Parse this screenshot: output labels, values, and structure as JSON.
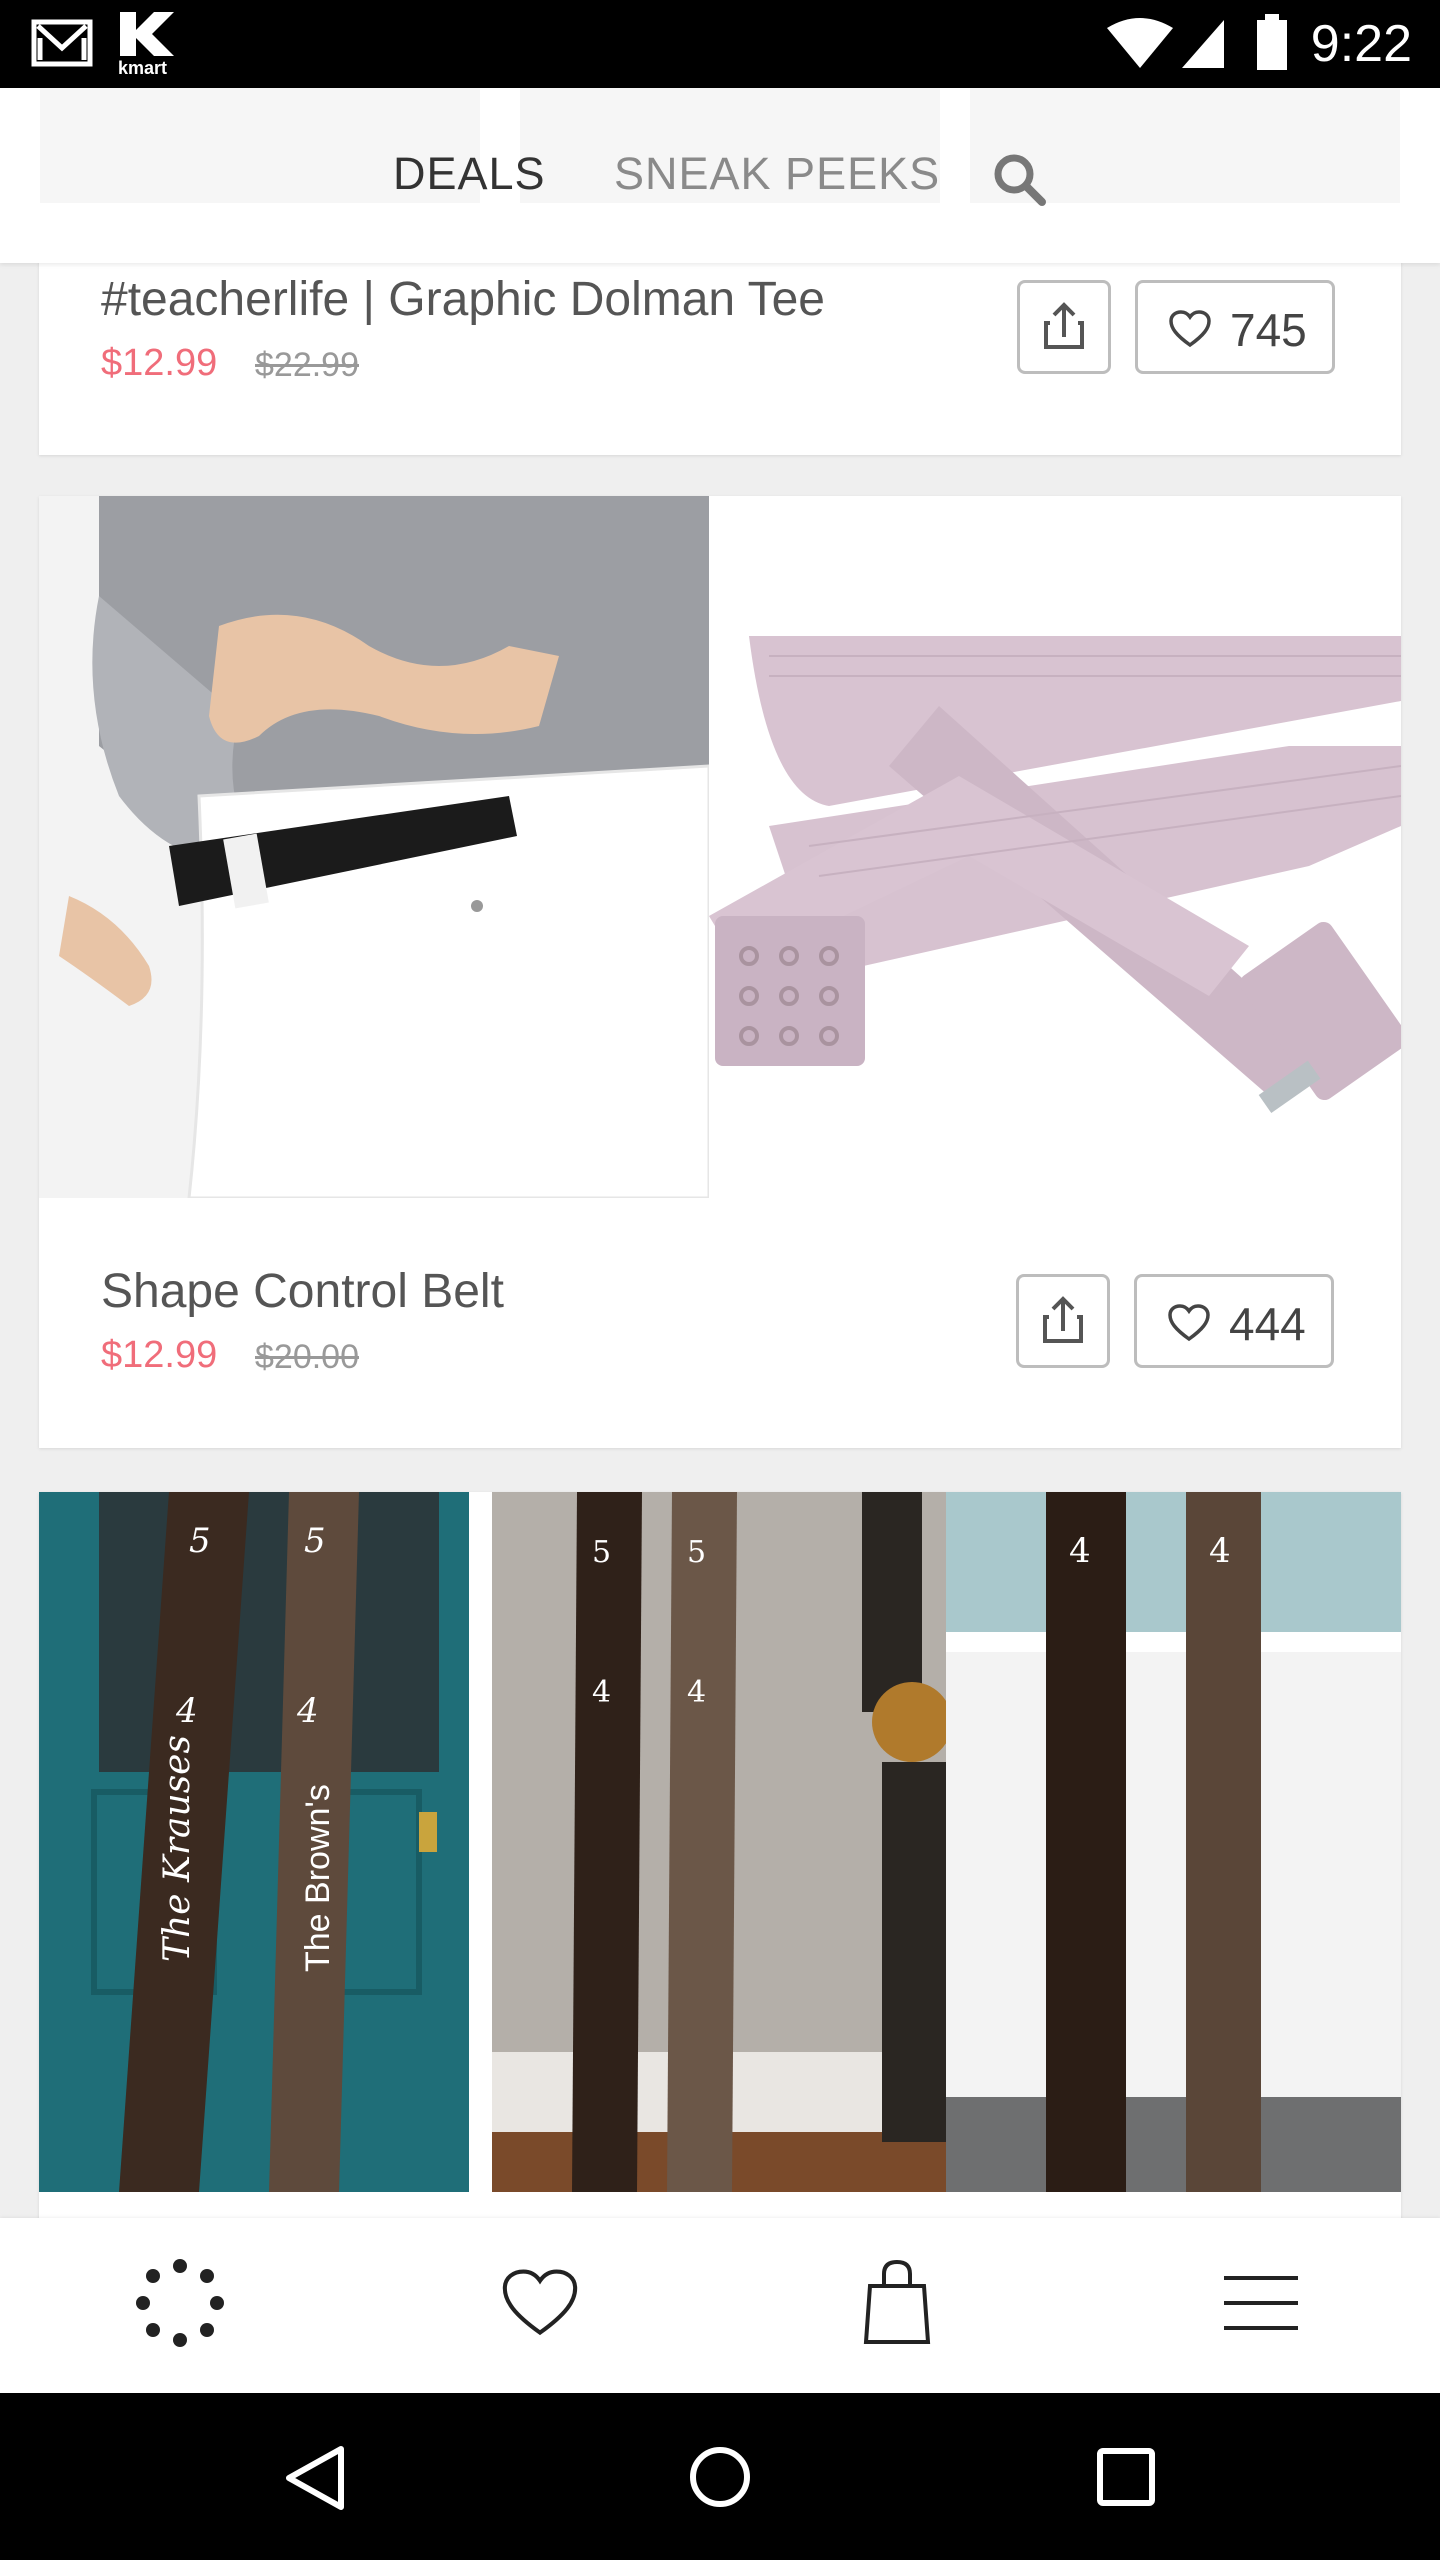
{
  "status_bar": {
    "time": "9:22",
    "carrier_label": "kmart",
    "icons": [
      "gmail-icon",
      "kmart-icon",
      "wifi-icon",
      "signal-icon",
      "battery-icon"
    ]
  },
  "top_nav": {
    "tabs": [
      {
        "label": "DEALS",
        "active": true
      },
      {
        "label": "SNEAK PEEKS",
        "active": false
      }
    ],
    "search_icon": "search-icon"
  },
  "products": [
    {
      "title": "#teacherlife | Graphic Dolman Tee",
      "price": "$12.99",
      "original_price": "$22.99",
      "likes": "745"
    },
    {
      "title": "Shape Control Belt",
      "price": "$12.99",
      "original_price": "$20.00",
      "likes": "444"
    },
    {
      "title": "",
      "image_texts": [
        "The Krauses",
        "The Brown's"
      ]
    }
  ],
  "bottom_bar": {
    "items": [
      "deals-icon",
      "favorites-icon",
      "bag-icon",
      "menu-icon"
    ]
  },
  "colors": {
    "sale_price": "#f06d7a",
    "door_teal": "#1f6e78",
    "wood_dark": "#3b2a20",
    "belt_lilac": "#d8c3d1"
  }
}
